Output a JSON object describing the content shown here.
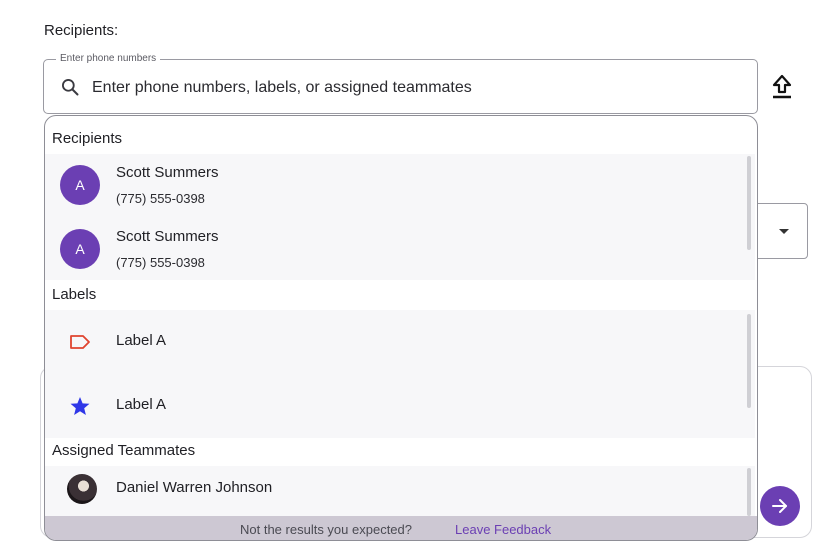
{
  "section_title": "Recipients:",
  "search": {
    "legend": "Enter phone numbers",
    "placeholder": "Enter phone numbers, labels, or assigned teammates"
  },
  "icons": {
    "search": "search-icon",
    "upload": "upload-icon",
    "label_outline": "label-outline-icon",
    "star": "star-icon",
    "send": "arrow-right-icon"
  },
  "colors": {
    "accent": "#6b3fb3",
    "label_red": "#e0442f",
    "star_blue": "#2f37e8"
  },
  "dropdown": {
    "recipients_title": "Recipients",
    "recipients": [
      {
        "initial": "A",
        "name": "Scott Summers",
        "phone": "(775) 555-0398"
      },
      {
        "initial": "A",
        "name": "Scott Summers",
        "phone": "(775) 555-0398"
      }
    ],
    "labels_title": "Labels",
    "labels": [
      {
        "name": "Label A",
        "icon": "label-outline-icon"
      },
      {
        "name": "Label A",
        "icon": "star-icon"
      }
    ],
    "teammates_title": "Assigned Teammates",
    "teammates": [
      {
        "name": "Daniel Warren Johnson"
      }
    ],
    "footer": {
      "text": "Not the results you expected?",
      "link": "Leave Feedback"
    }
  }
}
